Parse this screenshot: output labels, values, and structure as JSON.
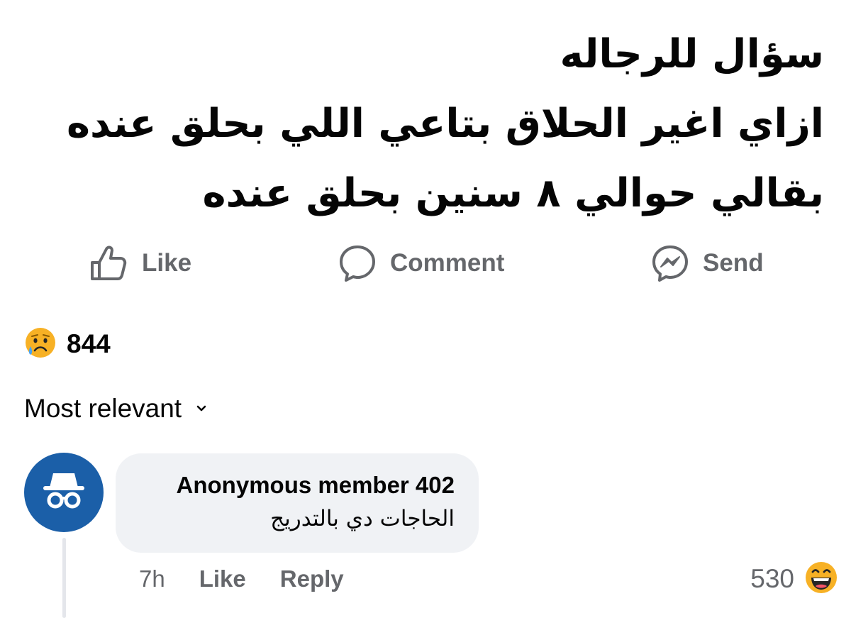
{
  "post": {
    "lines": [
      "سؤال للرجاله",
      "ازاي اغير الحلاق بتاعي اللي بحلق عنده",
      "بقالي حوالي ٨ سنين بحلق عنده"
    ]
  },
  "actions": {
    "like_label": "Like",
    "comment_label": "Comment",
    "send_label": "Send"
  },
  "reactions": {
    "icon": "sad-face-icon",
    "count": "844"
  },
  "sort": {
    "label": "Most relevant",
    "icon": "chevron-down-icon"
  },
  "comment": {
    "author": "Anonymous member 402",
    "text": "الحاجات دي بالتدريج",
    "time": "7h",
    "like_label": "Like",
    "reply_label": "Reply",
    "reaction_icon": "laughing-face-icon",
    "reaction_count": "530"
  },
  "colors": {
    "text": "#050505",
    "muted": "#65676b",
    "avatar_bg": "#1b5fa8",
    "bubble_bg": "#f0f2f5",
    "emoji_yellow": "#f7b125"
  }
}
